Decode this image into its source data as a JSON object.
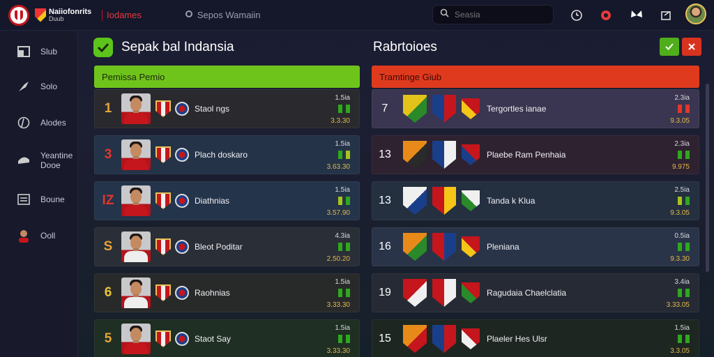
{
  "topbar": {
    "brand": "Naiiofonrits",
    "brand_sub": "Duub",
    "nav_active": "Iodames",
    "nav_item": "Sepos Wamaiin",
    "search_placeholder": "Seasia"
  },
  "sidebar": {
    "items": [
      {
        "label": "Slub",
        "icon": "club-icon"
      },
      {
        "label": "Solo",
        "icon": "whistle-icon"
      },
      {
        "label": "Alodes",
        "icon": "ball-icon"
      },
      {
        "label": "Yeantine Dooe",
        "icon": "cap-icon"
      },
      {
        "label": "Boune",
        "icon": "list-icon"
      },
      {
        "label": "Ooll",
        "icon": "player-icon"
      }
    ]
  },
  "left_panel": {
    "title": "Sepak bal Indansia",
    "header": "Pemissa Pemio",
    "rows": [
      {
        "rank": "1",
        "rank_color": "#e8a33a",
        "name": "Staol ngs",
        "stat_top": "1.5ia",
        "stat_bot": "3.3.30",
        "bar1": "#2fa81e",
        "bar2": "#2fa81e",
        "shirt": "red"
      },
      {
        "rank": "3",
        "rank_color": "#e2362a",
        "name": "Plach doskaro",
        "stat_top": "1.5ia",
        "stat_bot": "3.63.30",
        "bar1": "#2fa81e",
        "bar2": "#a6c41a",
        "shirt": "red"
      },
      {
        "rank": "IZ",
        "rank_color": "#e2362a",
        "name": "Diathnias",
        "stat_top": "1.5ia",
        "stat_bot": "3.57.90",
        "bar1": "#a6c41a",
        "bar2": "#2fa81e",
        "shirt": "crest"
      },
      {
        "rank": "S",
        "rank_color": "#e8a33a",
        "name": "Bleot Poditar",
        "stat_top": "4.3ia",
        "stat_bot": "2.50.20",
        "bar1": "#2fa81e",
        "bar2": "#2fa81e",
        "shirt": "white"
      },
      {
        "rank": "6",
        "rank_color": "#e8c53a",
        "name": "Raohnias",
        "stat_top": "1.5ia",
        "stat_bot": "3.33.30",
        "bar1": "#2fa81e",
        "bar2": "#2fa81e",
        "shirt": "white"
      },
      {
        "rank": "5",
        "rank_color": "#e8a33a",
        "name": "Staot Say",
        "stat_top": "1.5ia",
        "stat_bot": "3.33.30",
        "bar1": "#2fa81e",
        "bar2": "#2fa81e",
        "shirt": "red"
      }
    ]
  },
  "right_panel": {
    "title": "Rabrtoioes",
    "header": "Tramtinge Giub",
    "rows": [
      {
        "rank": "7",
        "name": "Tergortles ianae",
        "stat_top": "2.3ia",
        "stat_bot": "9.3.05",
        "bar1": "#e2362a",
        "bar2": "#e2362a"
      },
      {
        "rank": "13",
        "name": "Plaebe Ram Penhaia",
        "stat_top": "2.3ia",
        "stat_bot": "9.975",
        "bar1": "#2fa81e",
        "bar2": "#2fa81e"
      },
      {
        "rank": "13",
        "name": "Tanda k Klua",
        "stat_top": "2.5ia",
        "stat_bot": "9.3.05",
        "bar1": "#a6c41a",
        "bar2": "#2fa81e"
      },
      {
        "rank": "16",
        "name": "Pleniana",
        "stat_top": "0.5ia",
        "stat_bot": "9.3.30",
        "bar1": "#2fa81e",
        "bar2": "#2fa81e"
      },
      {
        "rank": "19",
        "name": "Ragudaia Chaelclatia",
        "stat_top": "3.4ia",
        "stat_bot": "3.33.05",
        "bar1": "#2fa81e",
        "bar2": "#2fa81e"
      },
      {
        "rank": "15",
        "name": "Plaeler Hes Ulsr",
        "stat_top": "1.5ia",
        "stat_bot": "3.3.05",
        "bar1": "#2fa81e",
        "bar2": "#2fa81e"
      }
    ]
  },
  "colors": {
    "accent_green": "#6fc41b",
    "accent_red": "#e03a1e"
  }
}
